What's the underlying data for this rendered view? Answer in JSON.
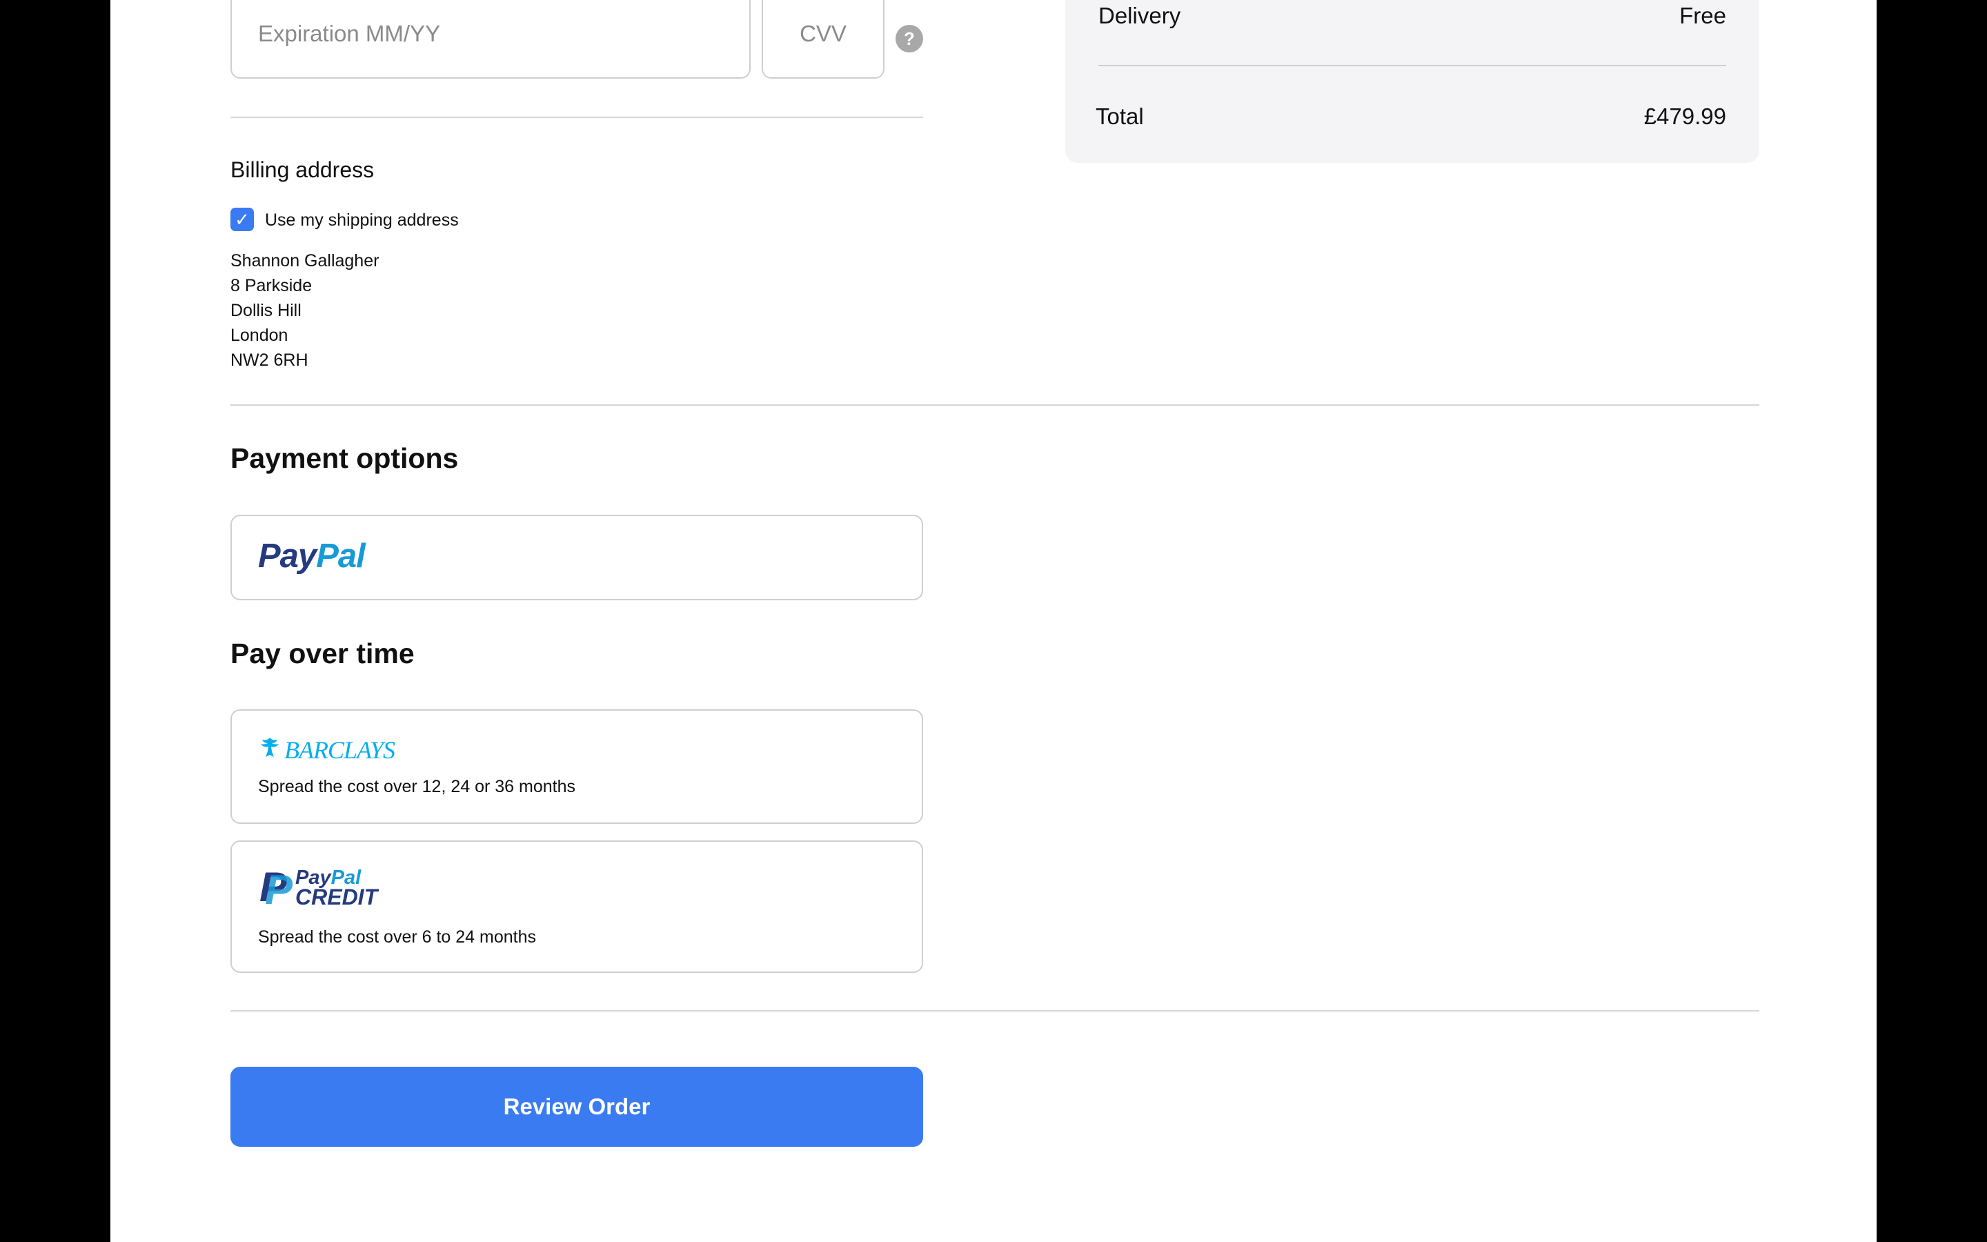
{
  "card": {
    "expiration_placeholder": "Expiration MM/YY",
    "cvv_placeholder": "CVV",
    "help_icon": "?"
  },
  "billing": {
    "title": "Billing address",
    "use_shipping_label": "Use my shipping address",
    "use_shipping_checked": true,
    "check_icon": "✓",
    "address": {
      "name": "Shannon Gallagher",
      "line1": "8 Parkside",
      "line2": "Dollis Hill",
      "city": "London",
      "postcode": "NW2 6RH"
    }
  },
  "payment_options": {
    "title": "Payment options",
    "paypal_logo_part1": "Pay",
    "paypal_logo_part2": "Pal"
  },
  "pay_over_time": {
    "title": "Pay over time",
    "barclays": {
      "logo_text": "BARCLAYS",
      "description": "Spread the cost over 12, 24 or 36 months"
    },
    "paypal_credit": {
      "logo_mark": "P",
      "logo_pay": "Pay",
      "logo_pal": "Pal",
      "logo_credit": "CREDIT",
      "description": "Spread the cost over 6 to 24 months"
    }
  },
  "review_button_label": "Review Order",
  "summary": {
    "delivery_label": "Delivery",
    "delivery_value": "Free",
    "total_label": "Total",
    "total_value": "£479.99"
  },
  "colors": {
    "accent": "#3a7bf2",
    "paypal_dark": "#253b80",
    "paypal_light": "#179bd7",
    "barclays": "#00aeef",
    "summary_bg": "#f4f4f6"
  }
}
